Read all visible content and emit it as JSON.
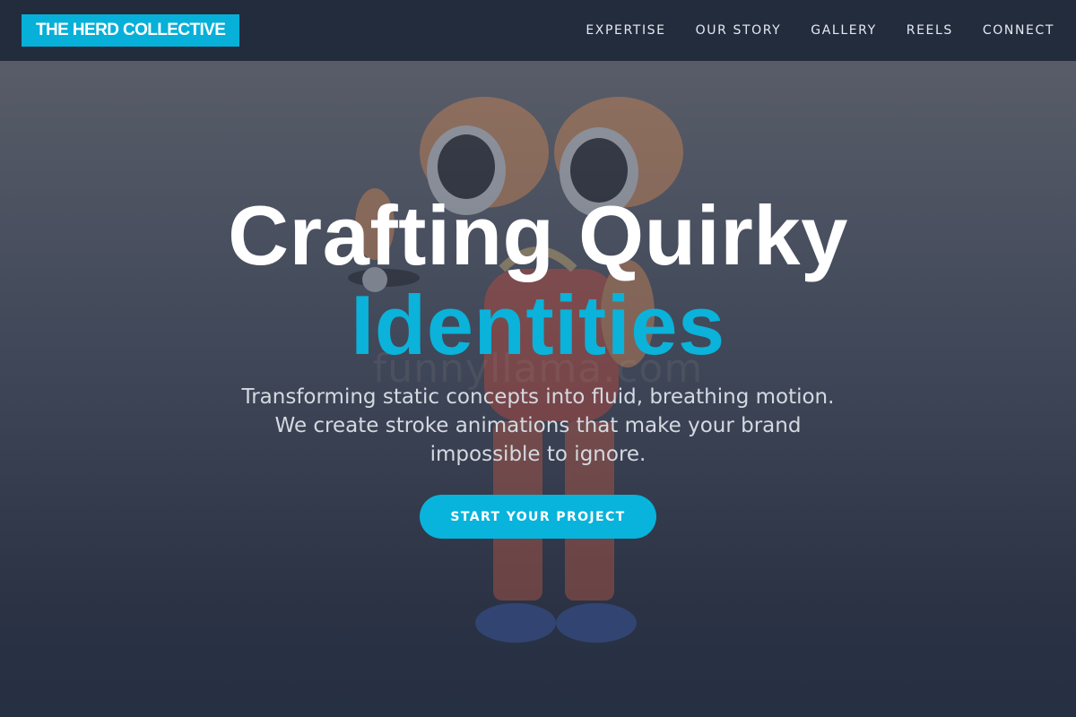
{
  "brand": {
    "name": "THE HERD COLLECTIVE",
    "accent": "#06b0d8"
  },
  "nav": {
    "links": [
      "EXPERTISE",
      "OUR STORY",
      "GALLERY",
      "REELS",
      "CONNECT"
    ]
  },
  "hero": {
    "title_line1": "Crafting Quirky",
    "title_line2": "Identities",
    "subtitle": "Transforming static concepts into fluid, breathing motion. We create stroke animations that make your brand impossible to ignore.",
    "cta_label": "START YOUR PROJECT",
    "background_image": "cartoon-character-illustration",
    "watermark": "funnyllama.com"
  }
}
